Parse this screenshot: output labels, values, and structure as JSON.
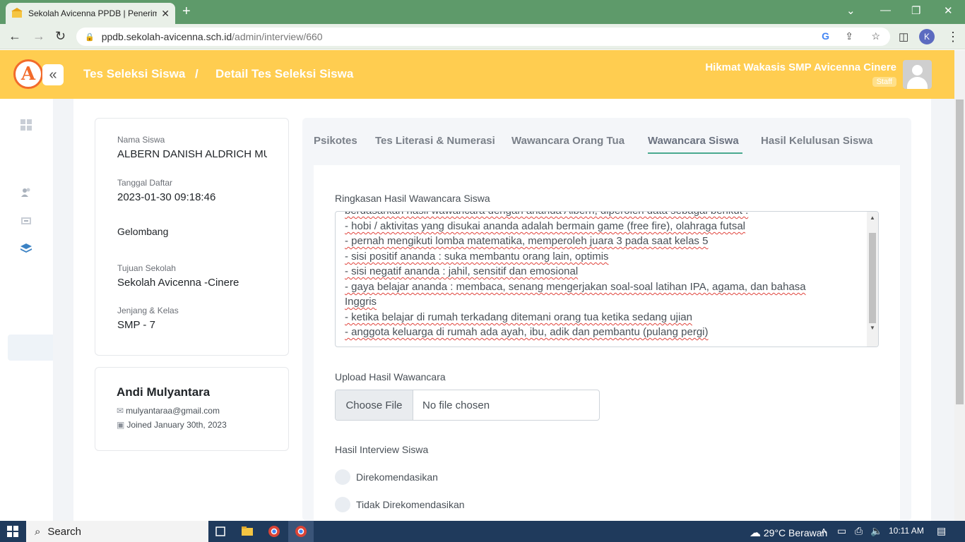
{
  "browser": {
    "tab_title": "Sekolah Avicenna PPDB | Penerim",
    "url_host": "ppdb.sekolah-avicenna.sch.id",
    "url_path": "/admin/interview/660",
    "profile_initial": "K"
  },
  "header": {
    "crumb1": "Tes Seleksi Siswa",
    "separator": "/",
    "crumb2": "Detail Tes Seleksi Siswa",
    "user_name": "Hikmat Wakasis SMP Avicenna Cinere",
    "user_role": "Staff"
  },
  "student": {
    "name_label": "Nama Siswa",
    "name_value": "ALBERN DANISH ALDRICH MULYANTARA",
    "date_label": "Tanggal Daftar",
    "date_value": "2023-01-30 09:18:46",
    "wave_label": "Gelombang",
    "school_label": "Tujuan Sekolah",
    "school_value": "Sekolah Avicenna -Cinere",
    "level_label": "Jenjang & Kelas",
    "level_value": "SMP - 7"
  },
  "parent": {
    "name": "Andi Mulyantara",
    "email": "mulyantaraa@gmail.com",
    "joined": "Joined January 30th, 2023"
  },
  "tabs": [
    {
      "label": "Psikotes"
    },
    {
      "label": "Tes Literasi & Numerasi"
    },
    {
      "label": "Wawancara Orang Tua"
    },
    {
      "label": "Wawancara Siswa"
    },
    {
      "label": "Hasil Kelulusan Siswa"
    }
  ],
  "form": {
    "summary_label": "Ringkasan Hasil Wawancara Siswa",
    "summary_lines": [
      "berdasarkan hasil wawancara dengan ananda Albern, diperoleh data sebagai berikut :",
      "- hobi / aktivitas yang disukai ananda adalah bermain game (free fire), olahraga futsal",
      "- pernah mengikuti lomba matematika, memperoleh juara 3 pada saat kelas 5",
      "- sisi positif ananda : suka membantu orang lain, optimis",
      "- sisi negatif ananda : jahil, sensitif dan emosional",
      "- gaya belajar ananda : membaca, senang mengerjakan soal-soal latihan IPA, agama, dan bahasa",
      "Inggris",
      "- ketika belajar di rumah terkadang ditemani orang tua ketika sedang ujian",
      "- anggota keluarga di rumah ada ayah, ibu, adik dan pembantu (pulang pergi)"
    ],
    "upload_label": "Upload Hasil Wawancara",
    "choose_file": "Choose File",
    "no_file": "No file chosen",
    "result_label": "Hasil Interview Siswa",
    "option1": "Direkomendasikan",
    "option2": "Tidak Direkomendasikan"
  },
  "taskbar": {
    "search": "Search",
    "weather": "29°C  Berawan",
    "time": "10:11 AM"
  },
  "colors": {
    "header_bg": "#ffcd50",
    "tab_active_underline": "#4aa98f",
    "browser_frame": "#5e9a6a"
  }
}
